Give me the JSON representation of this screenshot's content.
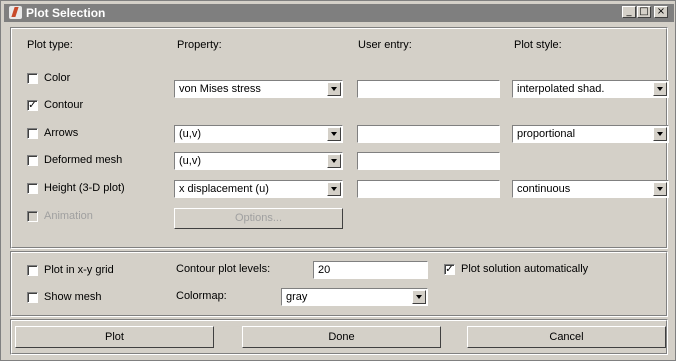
{
  "window": {
    "title": "Plot Selection",
    "minimize_label": "_",
    "maximize_label": "□",
    "close_label": "×"
  },
  "headers": {
    "plot_type": "Plot type:",
    "property": "Property:",
    "user_entry": "User entry:",
    "plot_style": "Plot style:"
  },
  "rows": [
    {
      "label": "Color",
      "checked": false,
      "enabled": true,
      "property": "von Mises stress",
      "user_entry": "",
      "plot_style": "interpolated shad."
    },
    {
      "label": "Contour",
      "checked": true,
      "enabled": true
    },
    {
      "label": "Arrows",
      "checked": false,
      "enabled": true,
      "property": "(u,v)",
      "user_entry": "",
      "plot_style": "proportional"
    },
    {
      "label": "Deformed mesh",
      "checked": false,
      "enabled": true,
      "property": "(u,v)",
      "user_entry": ""
    },
    {
      "label": "Height (3-D plot)",
      "checked": false,
      "enabled": true,
      "property": "x displacement (u)",
      "user_entry": "",
      "plot_style": "continuous"
    },
    {
      "label": "Animation",
      "checked": false,
      "enabled": false
    }
  ],
  "options_button": "Options...",
  "lower": {
    "plot_in_xy_grid": "Plot in x-y grid",
    "show_mesh": "Show mesh",
    "contour_levels_label": "Contour plot levels:",
    "contour_levels_value": "20",
    "colormap_label": "Colormap:",
    "colormap_value": "gray",
    "plot_auto": "Plot solution automatically",
    "plot_auto_checked": true
  },
  "buttons": {
    "plot": "Plot",
    "done": "Done",
    "cancel": "Cancel"
  },
  "check_glyph": "✓"
}
